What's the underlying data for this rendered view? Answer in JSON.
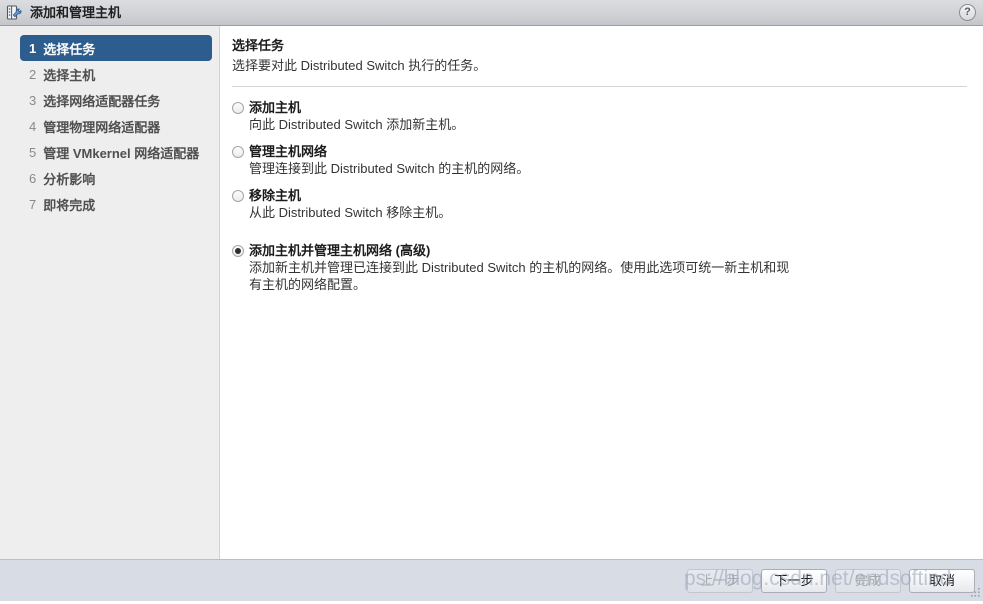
{
  "window": {
    "title": "添加和管理主机",
    "icon": "host-wrench-icon",
    "help_label": "?"
  },
  "sidebar": {
    "steps": [
      {
        "num": "1",
        "label": "选择任务",
        "active": true
      },
      {
        "num": "2",
        "label": "选择主机",
        "active": false
      },
      {
        "num": "3",
        "label": "选择网络适配器任务",
        "active": false
      },
      {
        "num": "4",
        "label": "管理物理网络适配器",
        "active": false
      },
      {
        "num": "5",
        "label": "管理 VMkernel 网络适配器",
        "active": false
      },
      {
        "num": "6",
        "label": "分析影响",
        "active": false
      },
      {
        "num": "7",
        "label": "即将完成",
        "active": false
      }
    ]
  },
  "content": {
    "title": "选择任务",
    "subtitle": "选择要对此 Distributed Switch 执行的任务。",
    "options": [
      {
        "label": "添加主机",
        "desc": "向此 Distributed Switch 添加新主机。",
        "selected": false
      },
      {
        "label": "管理主机网络",
        "desc": "管理连接到此 Distributed Switch 的主机的网络。",
        "selected": false
      },
      {
        "label": "移除主机",
        "desc": "从此 Distributed Switch 移除主机。",
        "selected": false
      },
      {
        "label": "添加主机并管理主机网络 (高级)",
        "desc": "添加新主机并管理已连接到此 Distributed Switch 的主机的网络。使用此选项可统一新主机和现有主机的网络配置。",
        "selected": true
      }
    ]
  },
  "footer": {
    "buttons": [
      {
        "label": "上一步",
        "disabled": true
      },
      {
        "label": "下一步",
        "disabled": false
      },
      {
        "label": "完成",
        "disabled": true
      },
      {
        "label": "取消",
        "disabled": false
      }
    ],
    "watermark": "ps://blog.csdn.net/endsoftind"
  },
  "colors": {
    "accent": "#2d5d8e",
    "titlebar": "#d2d3d7",
    "sidebar_bg": "#eeeeee",
    "footer_bg": "#d8dce4"
  }
}
